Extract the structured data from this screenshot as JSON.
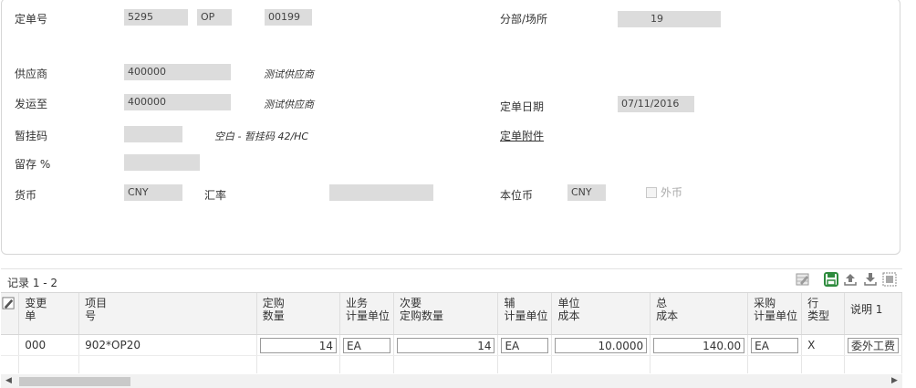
{
  "header": {
    "order_no_label": "定单号",
    "order_no": "5295",
    "order_type": "OP",
    "order_company": "00199",
    "branch_label": "分部/场所",
    "branch_value": "19",
    "supplier_label": "供应商",
    "supplier_no": "400000",
    "supplier_name": "测试供应商",
    "ship_to_label": "发运至",
    "ship_to_no": "400000",
    "ship_to_name": "测试供应商",
    "order_date_label": "定单日期",
    "order_date": "07/11/2016",
    "hold_code_label": "暂挂码",
    "hold_code_value": "",
    "hold_code_desc": "空白 - 暂挂码 42/HC",
    "attachments_link": "定单附件",
    "retainage_label": "留存 %",
    "retainage_value": "",
    "currency_label": "货币",
    "currency_value": "CNY",
    "exchange_rate_label": "汇率",
    "exchange_rate_value": "",
    "base_currency_label": "本位币",
    "base_currency_value": "CNY",
    "foreign_label": "外币",
    "foreign_checked": false
  },
  "grid": {
    "records_label": "记录 1 - 2",
    "columns": [
      {
        "line1": "变更",
        "line2": "单"
      },
      {
        "line1": "项目",
        "line2": "号"
      },
      {
        "line1": "定购",
        "line2": "数量"
      },
      {
        "line1": "业务",
        "line2": "计量单位"
      },
      {
        "line1": "次要",
        "line2": "定购数量"
      },
      {
        "line1": "辅",
        "line2": "计量单位"
      },
      {
        "line1": "单位",
        "line2": "成本"
      },
      {
        "line1": "总",
        "line2": "成本"
      },
      {
        "line1": "采购",
        "line2": "计量单位"
      },
      {
        "line1": "行",
        "line2": "类型"
      },
      {
        "line1": "说明 1",
        "line2": ""
      }
    ],
    "rows": [
      {
        "change_order": "000",
        "item_number": "902*OP20",
        "quantity": "14",
        "uom": "EA",
        "secondary_qty": "14",
        "secondary_uom": "EA",
        "unit_cost": "10.0000",
        "extended_cost": "140.00",
        "purchasing_uom": "EA",
        "line_type": "X",
        "description": "委外工费"
      }
    ]
  },
  "icons": {
    "edit_icon": "pencil-grid-icon",
    "save_icon": "save-icon",
    "export_icon": "upload-icon",
    "import_icon": "download-icon",
    "fullscreen_icon": "expand-icon",
    "row_header_icon": "attachment-edit-icon"
  },
  "colors": {
    "field_bg": "#dcdcdc",
    "save_icon": "#2e8b3d",
    "panel_border": "#d6d6d6"
  }
}
